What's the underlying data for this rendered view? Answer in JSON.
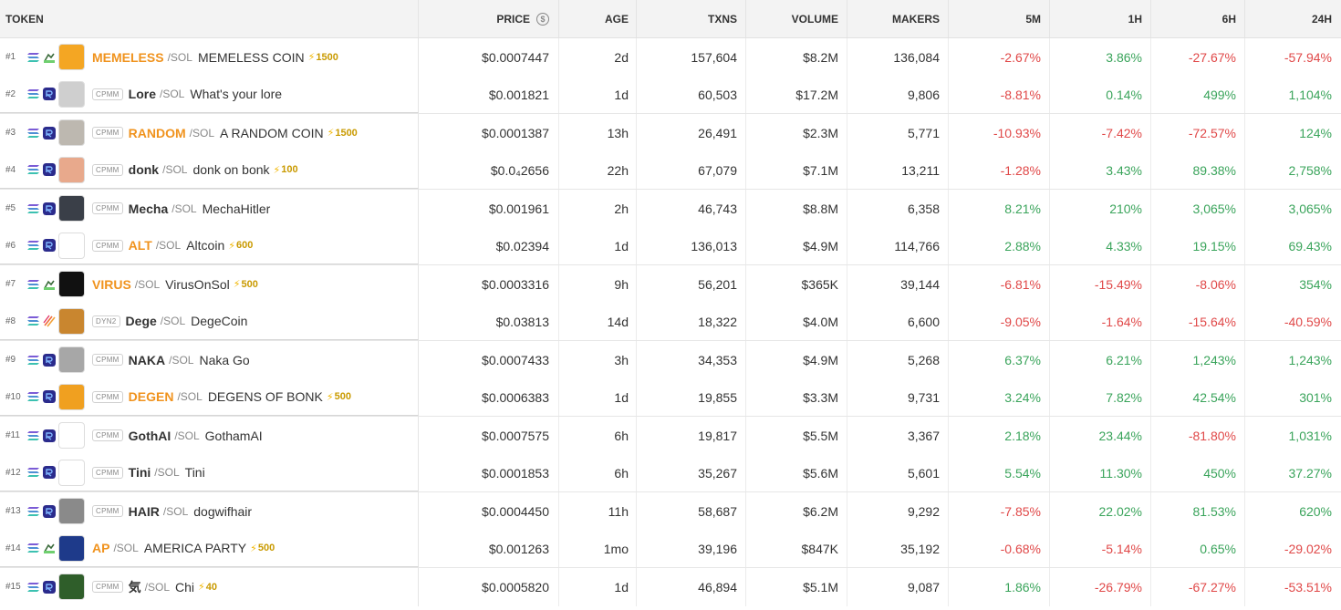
{
  "header": {
    "token": "TOKEN",
    "price": "PRICE",
    "age": "AGE",
    "txns": "TXNS",
    "volume": "VOLUME",
    "makers": "MAKERS",
    "m5": "5M",
    "h1": "1H",
    "h6": "6H",
    "h24": "24H"
  },
  "rows": [
    {
      "rank": "#1",
      "badge": "",
      "dex": "pump",
      "symbol": "MEMELESS",
      "symbol_color": "orange",
      "quote": "/SOL",
      "name": "MEMELESS COIN",
      "boost": "1500",
      "price": "$0.0007447",
      "age": "2d",
      "txns": "157,604",
      "volume": "$8.2M",
      "makers": "136,084",
      "m5": "-2.67%",
      "h1": "3.86%",
      "h6": "-27.67%",
      "h24": "-57.94%",
      "avatar_color": "#f4a623"
    },
    {
      "rank": "#2",
      "badge": "CPMM",
      "dex": "raydium",
      "symbol": "Lore",
      "symbol_color": "dark",
      "quote": "/SOL",
      "name": "What's your lore",
      "boost": "",
      "price": "$0.001821",
      "age": "1d",
      "txns": "60,503",
      "volume": "$17.2M",
      "makers": "9,806",
      "m5": "-8.81%",
      "h1": "0.14%",
      "h6": "499%",
      "h24": "1,104%",
      "avatar_color": "#cfcfcf"
    },
    {
      "rank": "#3",
      "badge": "CPMM",
      "dex": "raydium",
      "symbol": "RANDOM",
      "symbol_color": "orange",
      "quote": "/SOL",
      "name": "A RANDOM COIN",
      "boost": "1500",
      "price": "$0.0001387",
      "age": "13h",
      "txns": "26,491",
      "volume": "$2.3M",
      "makers": "5,771",
      "m5": "-10.93%",
      "h1": "-7.42%",
      "h6": "-72.57%",
      "h24": "124%",
      "avatar_color": "#bdb8b0"
    },
    {
      "rank": "#4",
      "badge": "CPMM",
      "dex": "raydium",
      "symbol": "donk",
      "symbol_color": "dark",
      "quote": "/SOL",
      "name": "donk on bonk",
      "boost": "100",
      "price": "$0.0₄2656",
      "age": "22h",
      "txns": "67,079",
      "volume": "$7.1M",
      "makers": "13,211",
      "m5": "-1.28%",
      "h1": "3.43%",
      "h6": "89.38%",
      "h24": "2,758%",
      "avatar_color": "#e8a98c"
    },
    {
      "rank": "#5",
      "badge": "CPMM",
      "dex": "raydium",
      "symbol": "Mecha",
      "symbol_color": "dark",
      "quote": "/SOL",
      "name": "MechaHitler",
      "boost": "",
      "price": "$0.001961",
      "age": "2h",
      "txns": "46,743",
      "volume": "$8.8M",
      "makers": "6,358",
      "m5": "8.21%",
      "h1": "210%",
      "h6": "3,065%",
      "h24": "3,065%",
      "avatar_color": "#3a3f48"
    },
    {
      "rank": "#6",
      "badge": "CPMM",
      "dex": "raydium",
      "symbol": "ALT",
      "symbol_color": "orange",
      "quote": "/SOL",
      "name": "Altcoin",
      "boost": "600",
      "price": "$0.02394",
      "age": "1d",
      "txns": "136,013",
      "volume": "$4.9M",
      "makers": "114,766",
      "m5": "2.88%",
      "h1": "4.33%",
      "h6": "19.15%",
      "h24": "69.43%",
      "avatar_color": "#ffffff"
    },
    {
      "rank": "#7",
      "badge": "",
      "dex": "pump",
      "symbol": "VIRUS",
      "symbol_color": "orange",
      "quote": "/SOL",
      "name": "VirusOnSol",
      "boost": "500",
      "price": "$0.0003316",
      "age": "9h",
      "txns": "56,201",
      "volume": "$365K",
      "makers": "39,144",
      "m5": "-6.81%",
      "h1": "-15.49%",
      "h6": "-8.06%",
      "h24": "354%",
      "avatar_color": "#111111"
    },
    {
      "rank": "#8",
      "badge": "DYN2",
      "dex": "meteora",
      "symbol": "Dege",
      "symbol_color": "dark",
      "quote": "/SOL",
      "name": "DegeCoin",
      "boost": "",
      "price": "$0.03813",
      "age": "14d",
      "txns": "18,322",
      "volume": "$4.0M",
      "makers": "6,600",
      "m5": "-9.05%",
      "h1": "-1.64%",
      "h6": "-15.64%",
      "h24": "-40.59%",
      "avatar_color": "#c9862f"
    },
    {
      "rank": "#9",
      "badge": "CPMM",
      "dex": "raydium",
      "symbol": "NAKA",
      "symbol_color": "dark",
      "quote": "/SOL",
      "name": "Naka Go",
      "boost": "",
      "price": "$0.0007433",
      "age": "3h",
      "txns": "34,353",
      "volume": "$4.9M",
      "makers": "5,268",
      "m5": "6.37%",
      "h1": "6.21%",
      "h6": "1,243%",
      "h24": "1,243%",
      "avatar_color": "#a7a7a7"
    },
    {
      "rank": "#10",
      "badge": "CPMM",
      "dex": "raydium",
      "symbol": "DEGEN",
      "symbol_color": "orange",
      "quote": "/SOL",
      "name": "DEGENS OF BONK",
      "boost": "500",
      "price": "$0.0006383",
      "age": "1d",
      "txns": "19,855",
      "volume": "$3.3M",
      "makers": "9,731",
      "m5": "3.24%",
      "h1": "7.82%",
      "h6": "42.54%",
      "h24": "301%",
      "avatar_color": "#f0a020"
    },
    {
      "rank": "#11",
      "badge": "CPMM",
      "dex": "raydium",
      "symbol": "GothAI",
      "symbol_color": "dark",
      "quote": "/SOL",
      "name": "GothamAI",
      "boost": "",
      "price": "$0.0007575",
      "age": "6h",
      "txns": "19,817",
      "volume": "$5.5M",
      "makers": "3,367",
      "m5": "2.18%",
      "h1": "23.44%",
      "h6": "-81.80%",
      "h24": "1,031%",
      "avatar_color": "#ffffff"
    },
    {
      "rank": "#12",
      "badge": "CPMM",
      "dex": "raydium",
      "symbol": "Tini",
      "symbol_color": "dark",
      "quote": "/SOL",
      "name": "Tini",
      "boost": "",
      "price": "$0.0001853",
      "age": "6h",
      "txns": "35,267",
      "volume": "$5.6M",
      "makers": "5,601",
      "m5": "5.54%",
      "h1": "11.30%",
      "h6": "450%",
      "h24": "37.27%",
      "avatar_color": "#ffffff"
    },
    {
      "rank": "#13",
      "badge": "CPMM",
      "dex": "raydium",
      "symbol": "HAIR",
      "symbol_color": "dark",
      "quote": "/SOL",
      "name": "dogwifhair",
      "boost": "",
      "price": "$0.0004450",
      "age": "11h",
      "txns": "58,687",
      "volume": "$6.2M",
      "makers": "9,292",
      "m5": "-7.85%",
      "h1": "22.02%",
      "h6": "81.53%",
      "h24": "620%",
      "avatar_color": "#8a8a8a"
    },
    {
      "rank": "#14",
      "badge": "",
      "dex": "pump",
      "symbol": "AP",
      "symbol_color": "orange",
      "quote": "/SOL",
      "name": "AMERICA PARTY",
      "boost": "500",
      "price": "$0.001263",
      "age": "1mo",
      "txns": "39,196",
      "volume": "$847K",
      "makers": "35,192",
      "m5": "-0.68%",
      "h1": "-5.14%",
      "h6": "0.65%",
      "h24": "-29.02%",
      "avatar_color": "#1e3a8a"
    },
    {
      "rank": "#15",
      "badge": "CPMM",
      "dex": "raydium",
      "symbol": "気",
      "symbol_color": "dark",
      "quote": "/SOL",
      "name": "Chi",
      "boost": "40",
      "price": "$0.0005820",
      "age": "1d",
      "txns": "46,894",
      "volume": "$5.1M",
      "makers": "9,087",
      "m5": "1.86%",
      "h1": "-26.79%",
      "h6": "-67.27%",
      "h24": "-53.51%",
      "avatar_color": "#2f5e2a"
    }
  ]
}
